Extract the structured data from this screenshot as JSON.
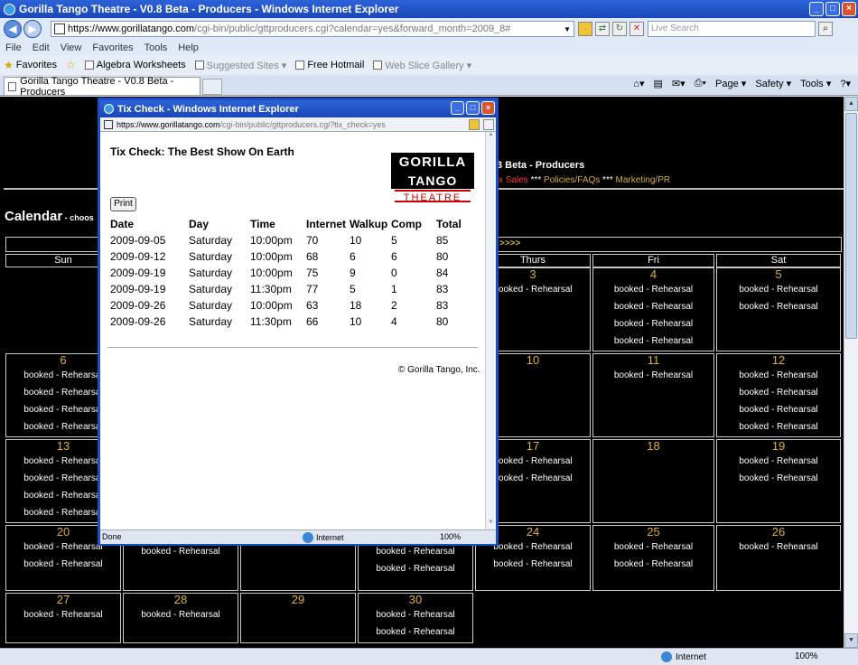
{
  "window": {
    "title": "Gorilla Tango Theatre - V0.8 Beta - Producers - Windows Internet Explorer",
    "url_scheme": "https://",
    "url_host": "www.gorillatango.com",
    "url_rest": "/cgi-bin/public/gttproducers.cgi?calendar=yes&forward_month=2009_8#",
    "search_placeholder": "Live Search",
    "menu": [
      "File",
      "Edit",
      "View",
      "Favorites",
      "Tools",
      "Help"
    ],
    "favorites_label": "Favorites",
    "favorites_bar": [
      "Algebra Worksheets",
      "Suggested Sites ▾",
      "Free Hotmail",
      "Web Slice Gallery ▾"
    ],
    "tab_label": "Gorilla Tango Theatre - V0.8 Beta - Producers",
    "commands": [
      "Page ▾",
      "Safety ▾",
      "Tools ▾"
    ],
    "status_zone": "Internet",
    "status_zoom": "100%"
  },
  "page": {
    "header_title": "3 Beta - Producers",
    "links": {
      "red": "x Sales",
      "sep": " *** ",
      "policies": "Policies/FAQs",
      "marketing": "Marketing/PR"
    },
    "calendar_title": "Calendar",
    "calendar_sub": " - choos",
    "next_link": ">>>>",
    "day_headers": [
      "Sun",
      "Thurs",
      "Fri",
      "Sat"
    ],
    "booked_label": "booked - Rehearsal",
    "cells": [
      {
        "num": "3",
        "items": 1
      },
      {
        "num": "4",
        "items": 4
      },
      {
        "num": "5",
        "items": 2
      },
      {
        "num": "6",
        "items": 4
      },
      {
        "num": "10",
        "items": 0
      },
      {
        "num": "11",
        "items": 1
      },
      {
        "num": "12",
        "items": 4
      },
      {
        "num": "13",
        "items": 4
      },
      {
        "num": "17",
        "items": 2
      },
      {
        "num": "18",
        "items": 0
      },
      {
        "num": "19",
        "items": 2
      },
      {
        "num": "20",
        "items": 2
      },
      {
        "num": "",
        "items": 2
      },
      {
        "num": "",
        "items": 1
      },
      {
        "num": "",
        "items": 3
      },
      {
        "num": "24",
        "items": 2
      },
      {
        "num": "25",
        "items": 2
      },
      {
        "num": "26",
        "items": 1
      },
      {
        "num": "27",
        "items": 1
      },
      {
        "num": "28",
        "items": 1
      },
      {
        "num": "29",
        "items": 0
      },
      {
        "num": "30",
        "items": 2
      }
    ]
  },
  "popup": {
    "title": "Tix Check - Windows Internet Explorer",
    "url_scheme": "https://",
    "url_host": "www.gorillatango.com",
    "url_rest": "/cgi-bin/public/gttproducers.cgi?tix_check=yes",
    "heading": "Tix Check: The Best Show On Earth",
    "logo_line1": "GORILLA",
    "logo_line2": "TANGO",
    "logo_line3": "THEATRE",
    "print_label": "Print",
    "columns": [
      "Date",
      "Day",
      "Time",
      "Internet",
      "Walkup",
      "Comp",
      "Total"
    ],
    "rows": [
      [
        "2009-09-05",
        "Saturday",
        "10:00pm",
        "70",
        "10",
        "5",
        "85"
      ],
      [
        "2009-09-12",
        "Saturday",
        "10:00pm",
        "68",
        "6",
        "6",
        "80"
      ],
      [
        "2009-09-19",
        "Saturday",
        "10:00pm",
        "75",
        "9",
        "0",
        "84"
      ],
      [
        "2009-09-19",
        "Saturday",
        "11:30pm",
        "77",
        "5",
        "1",
        "83"
      ],
      [
        "2009-09-26",
        "Saturday",
        "10:00pm",
        "63",
        "18",
        "2",
        "83"
      ],
      [
        "2009-09-26",
        "Saturday",
        "11:30pm",
        "66",
        "10",
        "4",
        "80"
      ]
    ],
    "copyright": "© Gorilla Tango, Inc.",
    "status_done": "Done",
    "status_zone": "Internet",
    "status_zoom": "100%"
  }
}
